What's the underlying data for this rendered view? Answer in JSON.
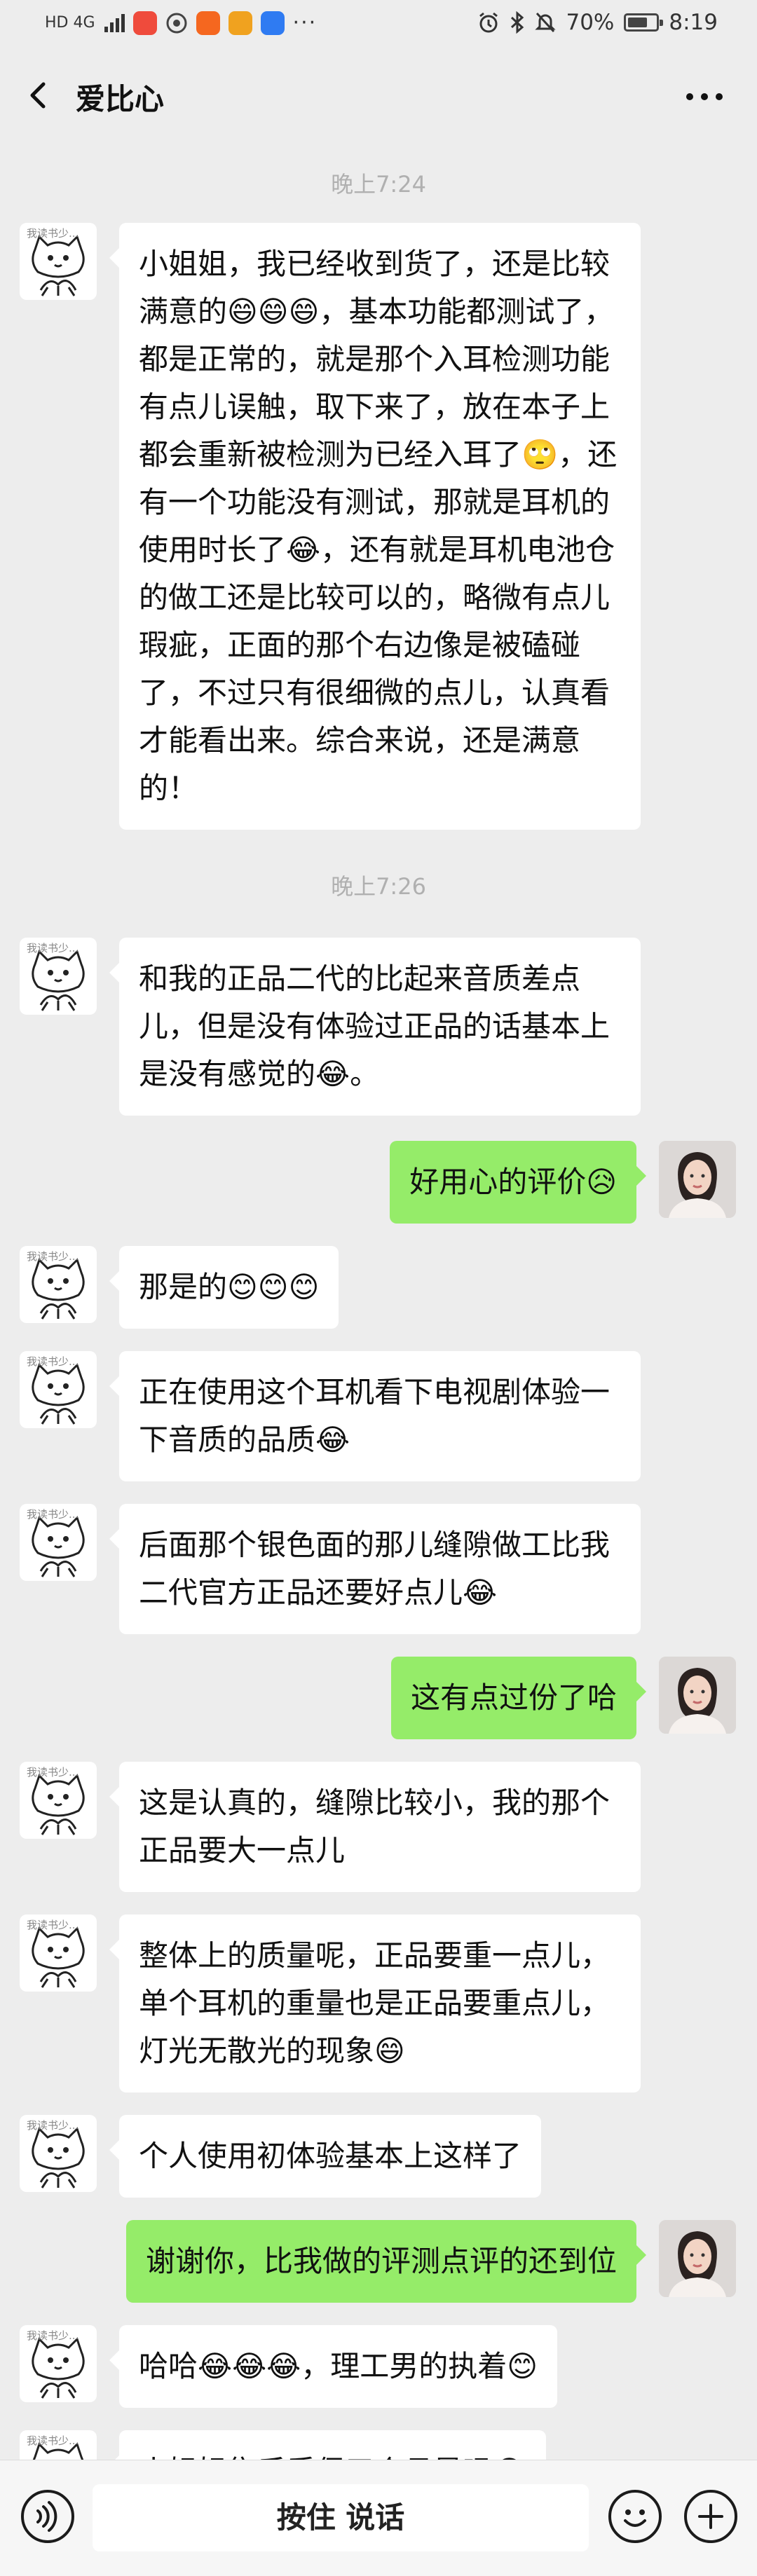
{
  "status_bar": {
    "network": "HD 4G",
    "battery": "70%",
    "battery_level": 0.7,
    "time": "8:19",
    "tile_colors": [
      "#ef4b3c",
      "#f5671f",
      "#f0a21f",
      "#2f7bf2"
    ]
  },
  "header": {
    "title": "爱比心",
    "back_icon": "chevron-left-icon",
    "more_icon": "ellipsis-icon"
  },
  "chat": {
    "time_1": "晚上7:24",
    "time_2": "晚上7:26",
    "messages": [
      {
        "from": "them",
        "text": "小姐姐，我已经收到货了，还是比较满意的😄😄😄，基本功能都测试了，都是正常的，就是那个入耳检测功能有点儿误触，取下来了，放在本子上都会重新被检测为已经入耳了🙄，还有一个功能没有测试，那就是耳机的使用时长了😂，还有就是耳机电池仓的做工还是比较可以的，略微有点儿瑕疵，正面的那个右边像是被磕碰了，不过只有很细微的点儿，认真看才能看出来。综合来说，还是满意的！"
      },
      {
        "from": "them",
        "text": "和我的正品二代的比起来音质差点儿，但是没有体验过正品的话基本上是没有感觉的😂。"
      },
      {
        "from": "me",
        "text": "好用心的评价😥"
      },
      {
        "from": "them",
        "text": "那是的😊😊😊"
      },
      {
        "from": "them",
        "text": "正在使用这个耳机看下电视剧体验一下音质的品质😂"
      },
      {
        "from": "them",
        "text": "后面那个银色面的那儿缝隙做工比我二代官方正品还要好点儿😂"
      },
      {
        "from": "me",
        "text": "这有点过份了哈"
      },
      {
        "from": "them",
        "text": "这是认真的，缝隙比较小，我的那个正品要大一点儿"
      },
      {
        "from": "them",
        "text": "整体上的质量呢，正品要重一点儿，单个耳机的重量也是正品要重点儿，灯光无散光的现象😄"
      },
      {
        "from": "them",
        "text": "个人使用初体验基本上这样了"
      },
      {
        "from": "me",
        "text": "谢谢你，比我做的评测点评的还到位"
      },
      {
        "from": "them",
        "text": "哈哈😂😂😂，理工男的执着😊"
      },
      {
        "from": "them",
        "text": "小姐姐售后质保三个月是吗😂"
      }
    ],
    "avatar_caption": "我读书少...",
    "their_avatar_icon": "cat-meme-avatar",
    "my_avatar_icon": "woman-portrait-avatar"
  },
  "input_bar": {
    "hold_to_talk": "按住 说话",
    "voice_icon": "voice-icon",
    "emoji_icon": "emoji-icon",
    "plus_icon": "plus-icon"
  },
  "colors": {
    "background": "#ededed",
    "my_bubble": "#95ec69",
    "their_bubble": "#ffffff",
    "time_text": "#b0b0b0"
  }
}
